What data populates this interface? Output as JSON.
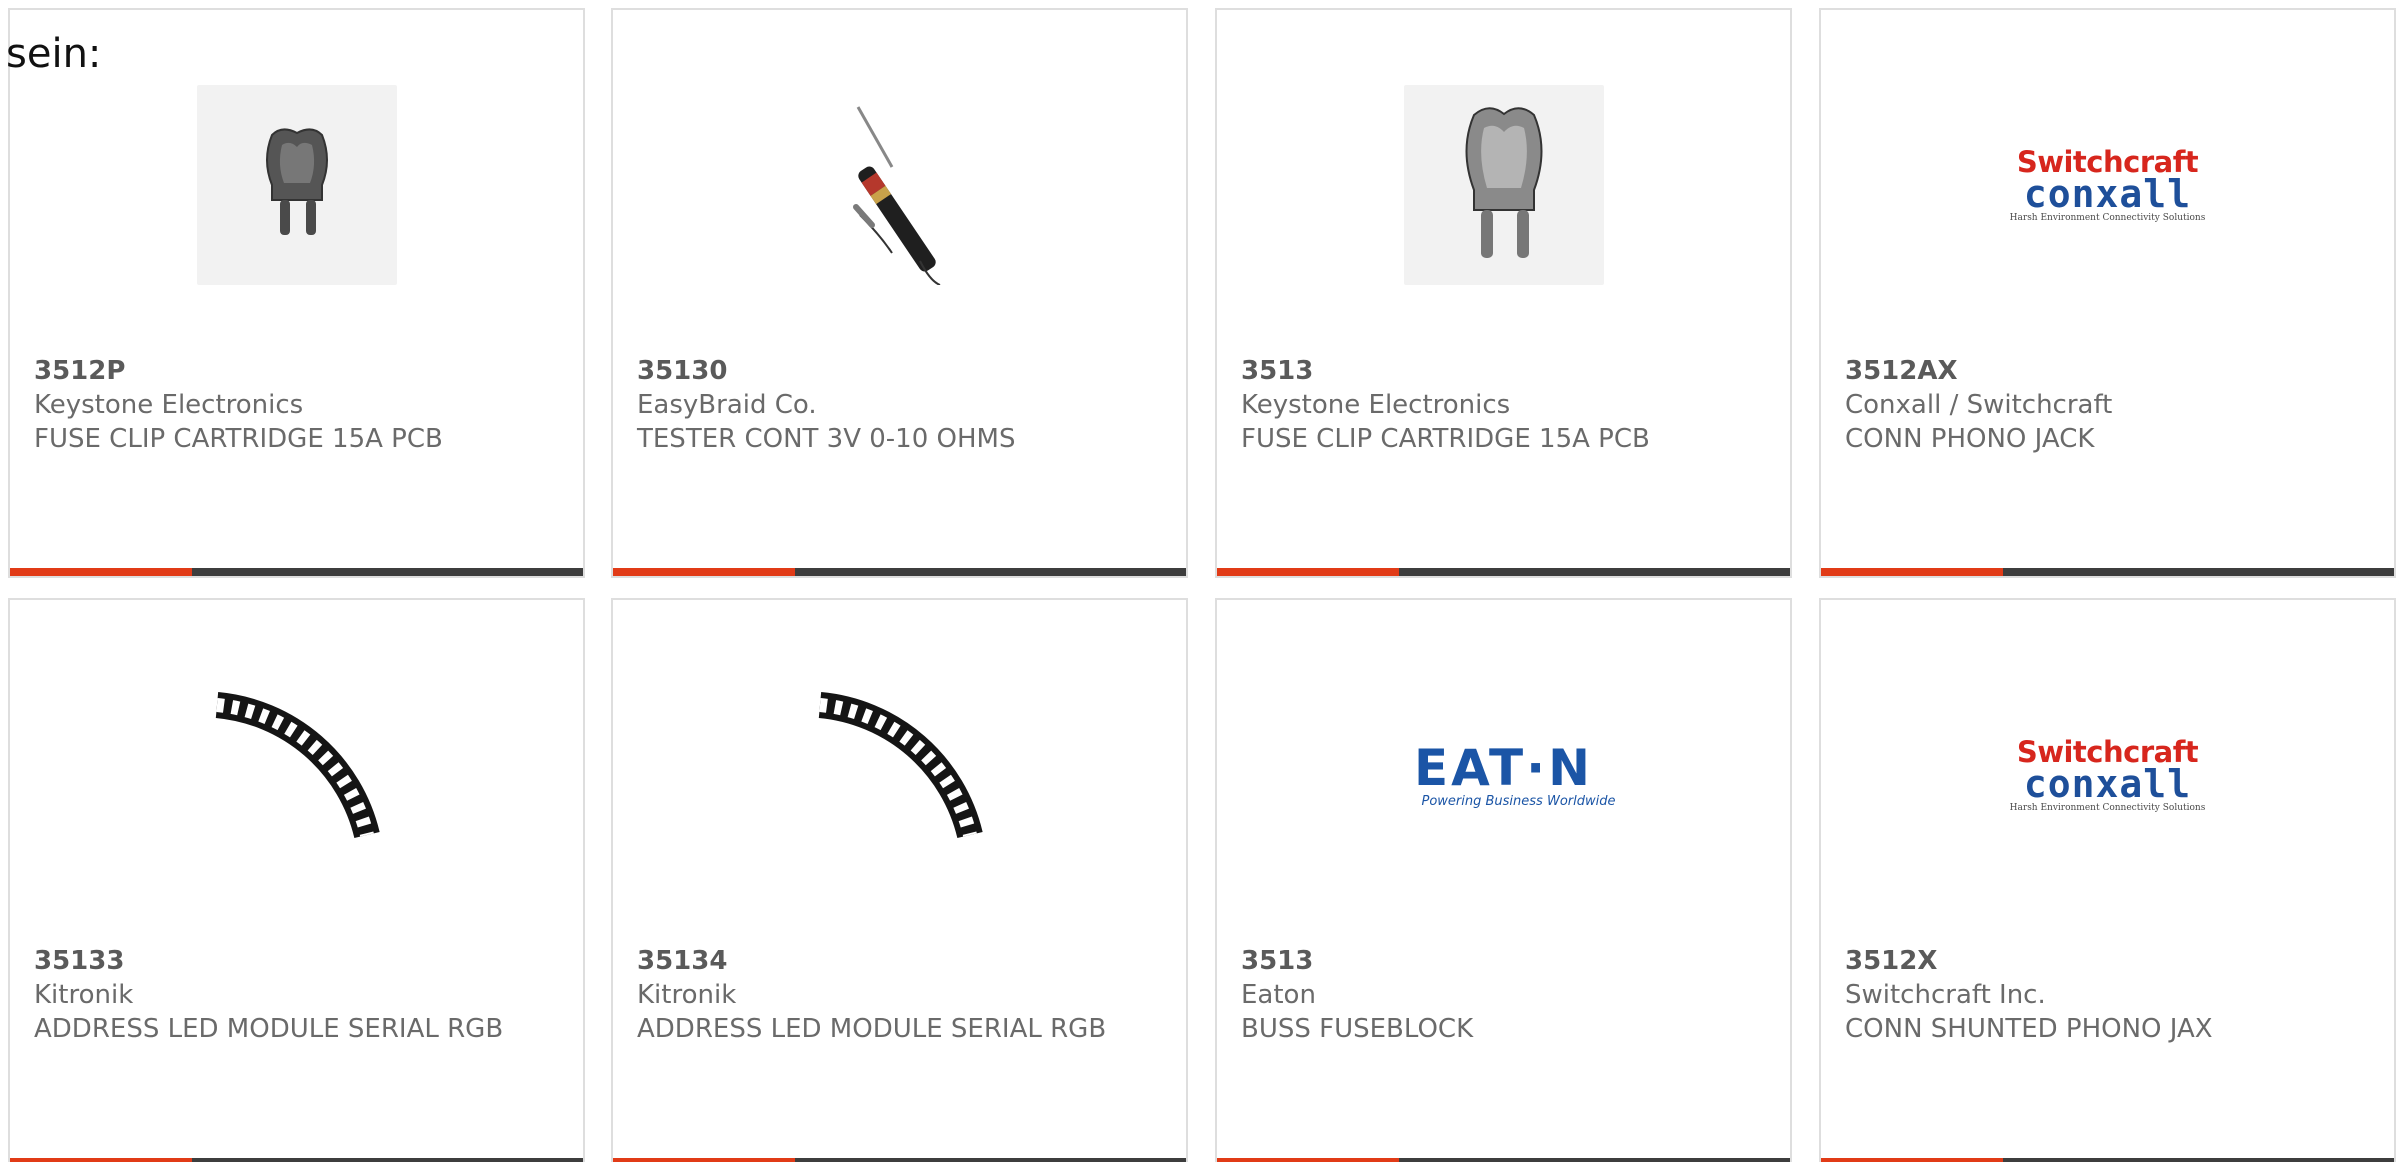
{
  "leading_text": "sein:",
  "cards": [
    {
      "part": "3512P",
      "manufacturer": "Keystone Electronics",
      "description": "FUSE CLIP CARTRIDGE 15A PCB",
      "image": "fuse-clip-image"
    },
    {
      "part": "35130",
      "manufacturer": "EasyBraid Co.",
      "description": "TESTER CONT 3V 0-10 OHMS",
      "image": "continuity-tester-image"
    },
    {
      "part": "3513",
      "manufacturer": "Keystone Electronics",
      "description": "FUSE CLIP CARTRIDGE 15A PCB",
      "image": "fuse-clip-image"
    },
    {
      "part": "3512AX",
      "manufacturer": "Conxall / Switchcraft",
      "description": "CONN PHONO JACK",
      "image": "switchcraft-conxall-logo"
    },
    {
      "part": "35133",
      "manufacturer": "Kitronik",
      "description": "ADDRESS LED MODULE SERIAL RGB",
      "image": "led-ring-quarter-image"
    },
    {
      "part": "35134",
      "manufacturer": "Kitronik",
      "description": "ADDRESS LED MODULE SERIAL RGB",
      "image": "led-ring-quarter-image"
    },
    {
      "part": "3513",
      "manufacturer": "Eaton",
      "description": "BUSS FUSEBLOCK",
      "image": "eaton-logo"
    },
    {
      "part": "3512X",
      "manufacturer": "Switchcraft Inc.",
      "description": "CONN SHUNTED PHONO JAX",
      "image": "switchcraft-conxall-logo"
    }
  ],
  "logos": {
    "switchcraft_top": "Switchcraft",
    "switchcraft_mid": "conxall",
    "switchcraft_bottom": "Harsh Environment Connectivity Solutions",
    "eaton_word": "EAT·N",
    "eaton_tagline": "Powering Business Worldwide"
  },
  "colors": {
    "accent": "#e13b17",
    "bar": "#3d3d3d",
    "border": "#dedede",
    "text": "#6a6a6a",
    "switchcraft_red": "#d7261d",
    "conxall_blue": "#1e4f9a",
    "eaton_blue": "#1b55a6"
  }
}
